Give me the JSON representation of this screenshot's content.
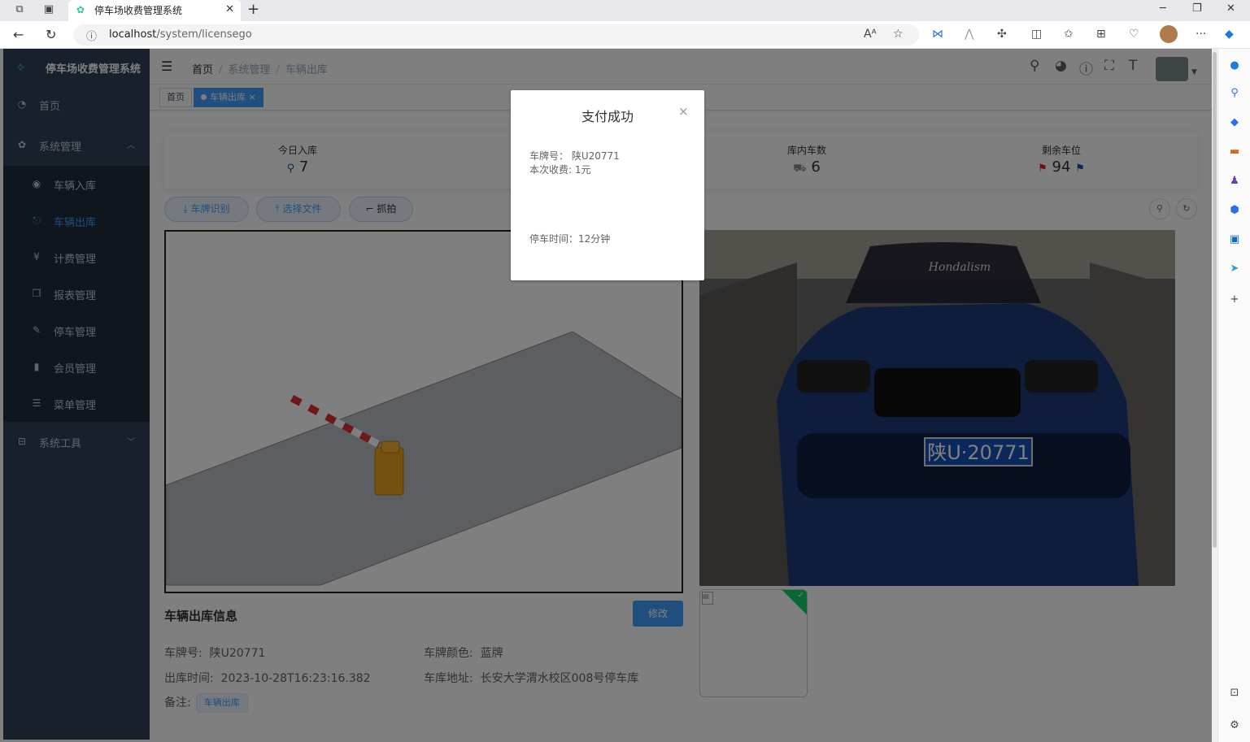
{
  "browser": {
    "tab_title": "停车场收费管理系统",
    "url_host": "localhost",
    "url_path": "/system/licensego",
    "new_tab_symbol": "+",
    "close_symbol": "✕"
  },
  "sidebar": {
    "title": "停车场收费管理系统",
    "items": [
      {
        "label": "首页",
        "icon": "dashboard-icon"
      },
      {
        "label": "系统管理",
        "icon": "gear-icon",
        "expanded": true
      },
      {
        "label": "系统工具",
        "icon": "toolbox-icon",
        "expanded": false
      }
    ],
    "submenu": [
      {
        "label": "车辆入库",
        "icon": "github-icon"
      },
      {
        "label": "车辆出库",
        "icon": "exit-icon",
        "active": true
      },
      {
        "label": "计费管理",
        "icon": "yen-icon"
      },
      {
        "label": "报表管理",
        "icon": "copy-icon"
      },
      {
        "label": "停车管理",
        "icon": "edit-icon"
      },
      {
        "label": "会员管理",
        "icon": "book-icon"
      },
      {
        "label": "菜单管理",
        "icon": "list-icon"
      }
    ]
  },
  "breadcrumb": {
    "home": "首页",
    "sep": "/",
    "level1": "系统管理",
    "level2": "车辆出库"
  },
  "tags": {
    "home": "首页",
    "active": "车辆出库",
    "active_close": "×"
  },
  "stats": {
    "today_in_label": "今日入库",
    "today_in_value": "7",
    "in_lot_label": "库内车数",
    "in_lot_value": "6",
    "remaining_label": "剩余车位",
    "remaining_value": "94"
  },
  "actions": {
    "recognize": "车牌识别",
    "select_file": "选择文件",
    "capture": "抓拍"
  },
  "exit_info": {
    "title": "车辆出库信息",
    "edit_button": "修改",
    "plate_label": "车牌号:",
    "plate_value": "陕U20771",
    "color_label": "车牌颜色:",
    "color_value": "蓝牌",
    "time_label": "出库时间:",
    "time_value": "2023-10-28T16:23:16.382",
    "address_label": "车库地址:",
    "address_value": "长安大学渭水校区008号停车库",
    "remark_label": "备注:",
    "remark_value": "车辆出库"
  },
  "car_photo": {
    "plate_text": "陕U·20771",
    "windshield_text": "Hondalism"
  },
  "dialog": {
    "title": "支付成功",
    "close": "×",
    "plate_line": "车牌号： 陕U20771",
    "fee_line": "本次收费: 1元",
    "duration_line": "停车时间：12分钟"
  },
  "colors": {
    "sidebar_bg": "#304156",
    "submenu_bg": "#1f2d3d",
    "primary": "#409eff",
    "overlay": "rgba(0,0,0,0.5)"
  }
}
